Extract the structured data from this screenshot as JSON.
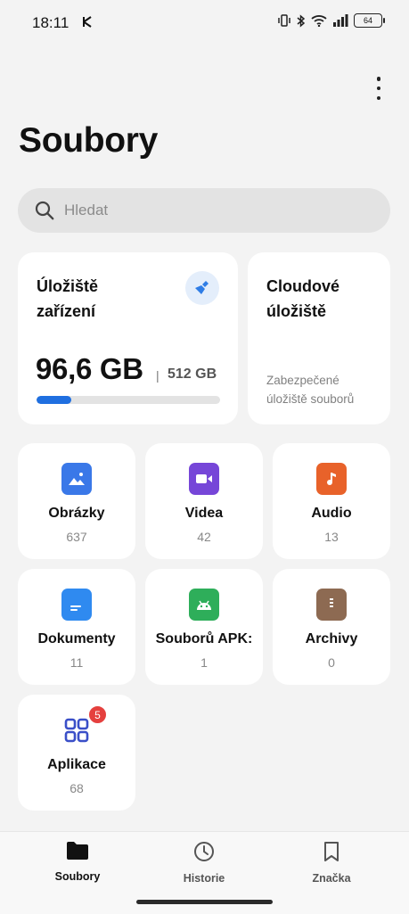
{
  "status": {
    "time": "18:11",
    "battery": "64"
  },
  "header": {
    "title": "Soubory"
  },
  "search": {
    "placeholder": "Hledat"
  },
  "device_storage": {
    "label_line1": "Úložiště",
    "label_line2": "zařízení",
    "used": "96,6 GB",
    "separator": "|",
    "total": "512 GB",
    "used_fraction": 0.19
  },
  "cloud_storage": {
    "label_line1": "Cloudové",
    "label_line2": "úložiště",
    "description": "Zabezpečené úložiště souborů"
  },
  "categories": [
    {
      "name": "Obrázky",
      "count": "637",
      "icon": "image-icon",
      "color": "#3a78e8"
    },
    {
      "name": "Videa",
      "count": "42",
      "icon": "video-icon",
      "color": "#7646d8"
    },
    {
      "name": "Audio",
      "count": "13",
      "icon": "music-icon",
      "color": "#e8622a"
    },
    {
      "name": "Dokumenty",
      "count": "11",
      "icon": "document-icon",
      "color": "#2f8af0"
    },
    {
      "name": "Souborů APK:",
      "count": "1",
      "icon": "android-icon",
      "color": "#2eae5a"
    },
    {
      "name": "Archivy",
      "count": "0",
      "icon": "archive-icon",
      "color": "#8d6a52"
    },
    {
      "name": "Aplikace",
      "count": "68",
      "icon": "apps-grid-icon",
      "color": "#3a4fc8",
      "badge": "5"
    }
  ],
  "nav": [
    {
      "label": "Soubory",
      "icon": "folder-icon"
    },
    {
      "label": "Historie",
      "icon": "clock-icon"
    },
    {
      "label": "Značka",
      "icon": "bookmark-icon"
    }
  ]
}
